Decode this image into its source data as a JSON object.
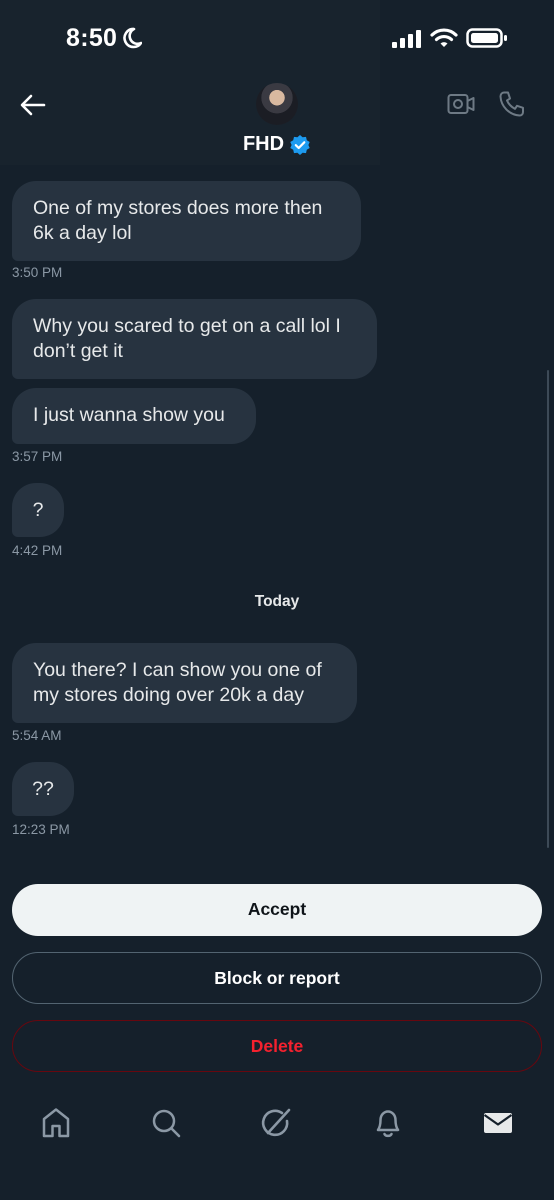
{
  "status_bar": {
    "time": "8:50"
  },
  "header": {
    "name": "FHD",
    "icons": {
      "back": "arrow-left-icon",
      "verified": "verified-badge-icon",
      "video": "video-camera-icon",
      "phone": "phone-icon"
    }
  },
  "messages": [
    {
      "text": "One of my stores does more then 6k a day lol",
      "time": "3:50 PM"
    },
    {
      "text": "Why you scared to get on a call lol I don’t get it",
      "time": ""
    },
    {
      "text": "I just wanna show you",
      "time": "3:57 PM"
    },
    {
      "text": "?",
      "time": "4:42 PM"
    },
    {
      "text": "You there? I can show you one of my stores doing over 20k a day",
      "time": "5:54 AM"
    },
    {
      "text": "??",
      "time": "12:23 PM"
    }
  ],
  "day_separator": "Today",
  "actions": {
    "accept": "Accept",
    "block": "Block or report",
    "delete": "Delete"
  },
  "tabbar": {
    "items": [
      "home-icon",
      "search-icon",
      "grok-icon",
      "notifications-bell-icon",
      "messages-envelope-icon"
    ]
  },
  "colors": {
    "background": "#15202b",
    "bubble": "#273340",
    "timestamp": "#8b98a5",
    "accent": "#1d9bf0",
    "danger": "#f4212e"
  }
}
